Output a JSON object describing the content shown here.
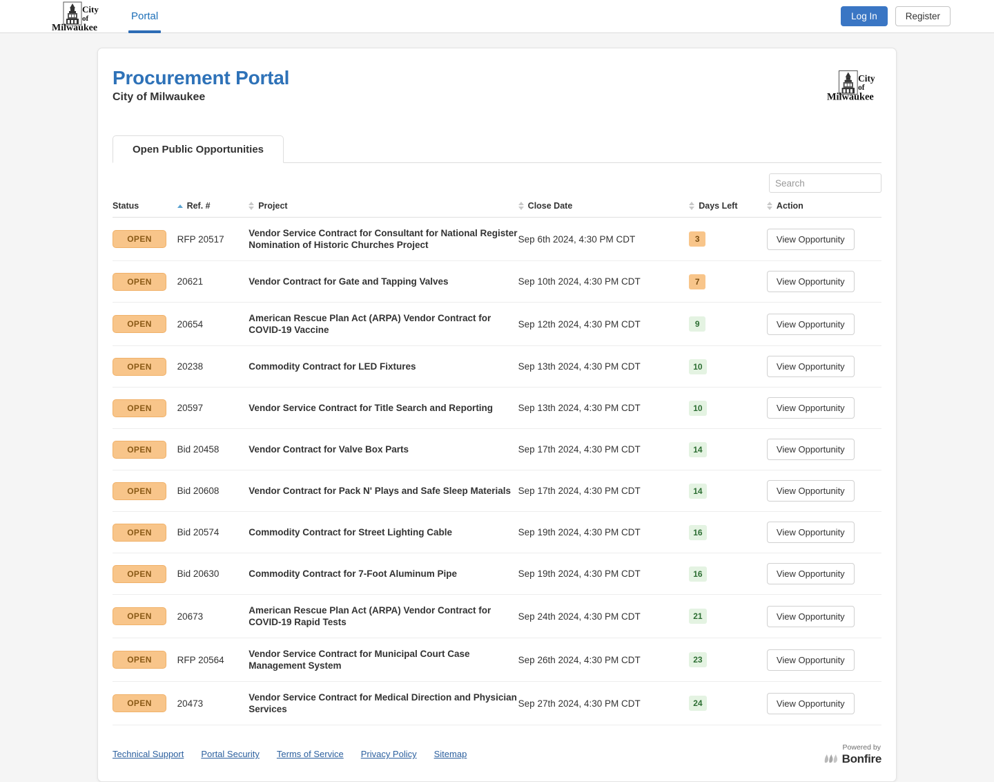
{
  "navbar": {
    "logo_alt": "City of Milwaukee",
    "links": [
      {
        "label": "Portal",
        "active": true
      }
    ],
    "login_label": "Log In",
    "register_label": "Register"
  },
  "header": {
    "title": "Procurement Portal",
    "subtitle": "City of Milwaukee",
    "logo_alt": "City of Milwaukee"
  },
  "tabs": [
    {
      "label": "Open Public Opportunities",
      "active": true
    }
  ],
  "search": {
    "placeholder": "Search",
    "value": ""
  },
  "table": {
    "columns": [
      {
        "key": "status",
        "label": "Status",
        "sort": "asc"
      },
      {
        "key": "ref",
        "label": "Ref. #",
        "sort": "none"
      },
      {
        "key": "project",
        "label": "Project",
        "sort": "none"
      },
      {
        "key": "close",
        "label": "Close Date",
        "sort": "none"
      },
      {
        "key": "days",
        "label": "Days Left",
        "sort": "none"
      },
      {
        "key": "action",
        "label": "Action",
        "sort": "none"
      }
    ],
    "action_label": "View Opportunity",
    "rows": [
      {
        "status": "OPEN",
        "ref": "RFP 20517",
        "project": "Vendor Service Contract for Consultant for National Register Nomination of Historic Churches Project",
        "close": "Sep 6th 2024, 4:30 PM CDT",
        "days": "3",
        "days_level": "warn"
      },
      {
        "status": "OPEN",
        "ref": "20621",
        "project": "Vendor Contract for Gate and Tapping Valves",
        "close": "Sep 10th 2024, 4:30 PM CDT",
        "days": "7",
        "days_level": "warn"
      },
      {
        "status": "OPEN",
        "ref": "20654",
        "project": "American Rescue Plan Act (ARPA) Vendor Contract for COVID-19 Vaccine",
        "close": "Sep 12th 2024, 4:30 PM CDT",
        "days": "9",
        "days_level": "ok"
      },
      {
        "status": "OPEN",
        "ref": "20238",
        "project": "Commodity Contract for LED Fixtures",
        "close": "Sep 13th 2024, 4:30 PM CDT",
        "days": "10",
        "days_level": "ok"
      },
      {
        "status": "OPEN",
        "ref": "20597",
        "project": "Vendor Service Contract for Title Search and Reporting",
        "close": "Sep 13th 2024, 4:30 PM CDT",
        "days": "10",
        "days_level": "ok"
      },
      {
        "status": "OPEN",
        "ref": "Bid 20458",
        "project": "Vendor Contract for Valve Box Parts",
        "close": "Sep 17th 2024, 4:30 PM CDT",
        "days": "14",
        "days_level": "ok"
      },
      {
        "status": "OPEN",
        "ref": "Bid 20608",
        "project": "Vendor Contract for Pack N' Plays and Safe Sleep Materials",
        "close": "Sep 17th 2024, 4:30 PM CDT",
        "days": "14",
        "days_level": "ok"
      },
      {
        "status": "OPEN",
        "ref": "Bid 20574",
        "project": "Commodity Contract for Street Lighting Cable",
        "close": "Sep 19th 2024, 4:30 PM CDT",
        "days": "16",
        "days_level": "ok"
      },
      {
        "status": "OPEN",
        "ref": "Bid 20630",
        "project": "Commodity Contract for 7-Foot Aluminum Pipe",
        "close": "Sep 19th 2024, 4:30 PM CDT",
        "days": "16",
        "days_level": "ok"
      },
      {
        "status": "OPEN",
        "ref": "20673",
        "project": "American Rescue Plan Act (ARPA) Vendor Contract for COVID-19 Rapid Tests",
        "close": "Sep 24th 2024, 4:30 PM CDT",
        "days": "21",
        "days_level": "ok"
      },
      {
        "status": "OPEN",
        "ref": "RFP 20564",
        "project": "Vendor Service Contract for Municipal Court Case Management System",
        "close": "Sep 26th 2024, 4:30 PM CDT",
        "days": "23",
        "days_level": "ok"
      },
      {
        "status": "OPEN",
        "ref": "20473",
        "project": "Vendor Service Contract for Medical Direction and Physician Services",
        "close": "Sep 27th 2024, 4:30 PM CDT",
        "days": "24",
        "days_level": "ok"
      }
    ]
  },
  "footer": {
    "links": [
      "Technical Support",
      "Portal Security",
      "Terms of Service",
      "Privacy Policy",
      "Sitemap"
    ],
    "powered_by": "Powered by",
    "vendor": "Bonfire"
  },
  "colors": {
    "brand_blue": "#2e72b8",
    "link_blue": "#2b5f9e",
    "open_badge": "#f8c58a",
    "days_warn": "#f8c58a",
    "days_ok": "#e4f3e2",
    "days_ok_text": "#2d6e33"
  }
}
